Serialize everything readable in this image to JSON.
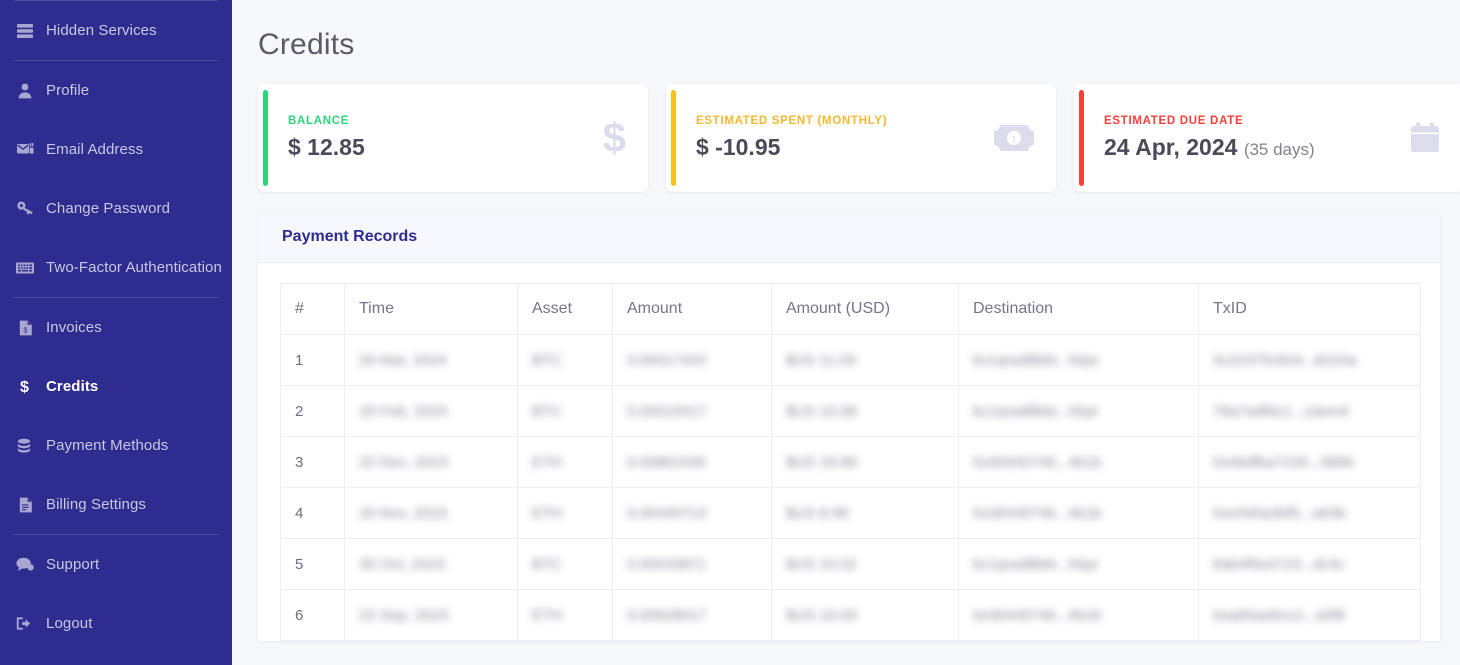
{
  "sidebar": {
    "items": [
      {
        "label": "Hidden Services",
        "icon": "server-icon",
        "active": false
      },
      {
        "label": "Profile",
        "icon": "user-icon",
        "active": false
      },
      {
        "label": "Email Address",
        "icon": "mail-icon",
        "active": false
      },
      {
        "label": "Change Password",
        "icon": "key-icon",
        "active": false
      },
      {
        "label": "Two-Factor Authentication",
        "icon": "keyboard-icon",
        "active": false
      },
      {
        "label": "Invoices",
        "icon": "invoice-icon",
        "active": false
      },
      {
        "label": "Credits",
        "icon": "dollar-icon",
        "active": true
      },
      {
        "label": "Payment Methods",
        "icon": "coins-icon",
        "active": false
      },
      {
        "label": "Billing Settings",
        "icon": "document-icon",
        "active": false
      },
      {
        "label": "Support",
        "icon": "chat-icon",
        "active": false
      },
      {
        "label": "Logout",
        "icon": "logout-icon",
        "active": false
      }
    ]
  },
  "page": {
    "title": "Credits"
  },
  "cards": [
    {
      "label": "BALANCE",
      "value": "$ 12.85",
      "sub": "",
      "accent": "#2ed47a",
      "label_color": "#2ed47a",
      "icon": "dollar-sign-icon"
    },
    {
      "label": "ESTIMATED SPENT (MONTHLY)",
      "value": "$ -10.95",
      "sub": "",
      "accent": "#fcc21b",
      "label_color": "#f7b731",
      "icon": "money-bill-icon"
    },
    {
      "label": "ESTIMATED DUE DATE",
      "value": "24 Apr, 2024",
      "sub": "(35 days)",
      "accent": "#f4403a",
      "label_color": "#f4403a",
      "icon": "calendar-icon"
    }
  ],
  "panel": {
    "title": "Payment Records",
    "columns": [
      "#",
      "Time",
      "Asset",
      "Amount",
      "Amount (USD)",
      "Destination",
      "TxID"
    ],
    "rows": [
      {
        "num": "1",
        "time": "20 Mar, 2024",
        "asset": "BTC",
        "amount": "0.00017442",
        "amount_usd": "$US 11.03",
        "destination": "bc1qrad8bbt...hbpr",
        "txid": "4c22375c8c9...8223a"
      },
      {
        "num": "2",
        "time": "29 Feb, 2024",
        "asset": "BTC",
        "amount": "0.00019417",
        "amount_usd": "$US 10.08",
        "destination": "bc1qrad8bbt...hbpr",
        "txid": "78a7adfdc1...cdem4"
      },
      {
        "num": "3",
        "time": "22 Dec, 2023",
        "asset": "ETH",
        "amount": "0.00862430",
        "amount_usd": "$US 18.89",
        "destination": "0x30440746...4b1b",
        "txid": "0x4bdfba7230...089b"
      },
      {
        "num": "4",
        "time": "20 Nov, 2023",
        "asset": "ETH",
        "amount": "0.00449713",
        "amount_usd": "$US 8.96",
        "destination": "0x30440746...4b1b",
        "txid": "0xe340a30f5...a63b"
      },
      {
        "num": "5",
        "time": "30 Oct, 2023",
        "asset": "BTC",
        "amount": "0.00033871",
        "amount_usd": "$US 10.02",
        "destination": "bc1qrad8bbt...hbpr",
        "txid": "8ab4f9a4723...dc4c"
      },
      {
        "num": "6",
        "time": "22 Sep, 2023",
        "asset": "ETH",
        "amount": "0.00628017",
        "amount_usd": "$US 10.00",
        "destination": "0x30440746...4b1b",
        "txid": "0xa65ae81c2...a9f8"
      }
    ]
  }
}
